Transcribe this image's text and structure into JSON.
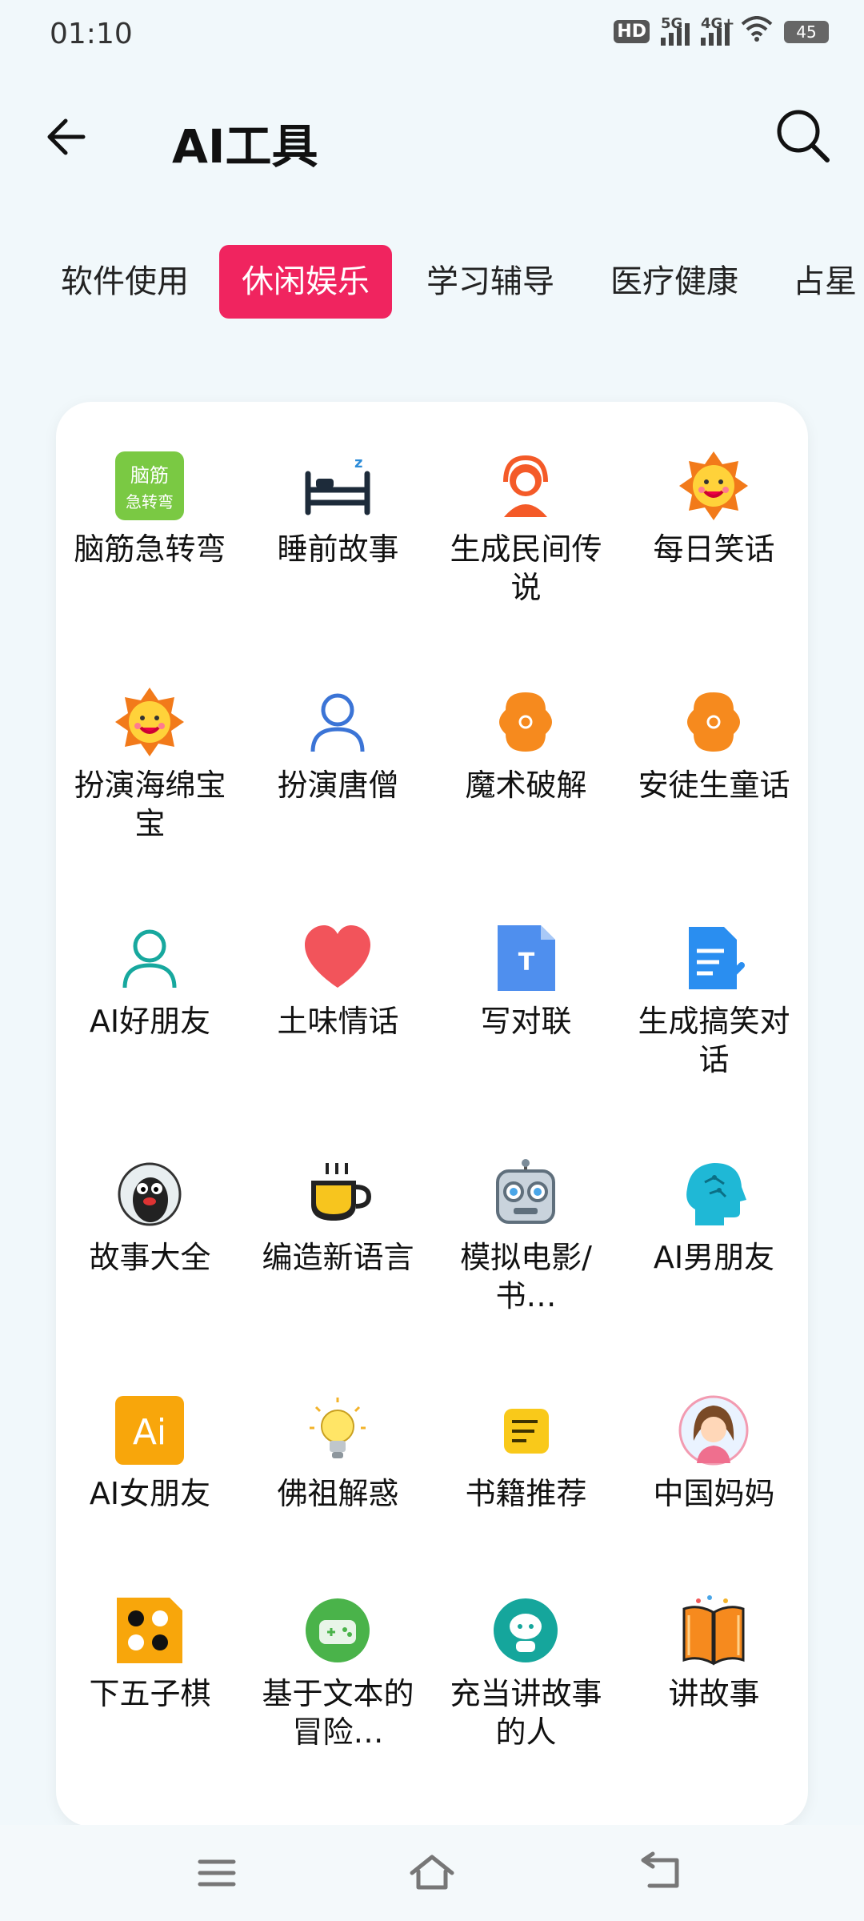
{
  "status_bar": {
    "time": "01:10",
    "hd": "HD",
    "net1": "5G",
    "net2": "4G+",
    "battery": "45"
  },
  "header": {
    "title": "AI工具",
    "back_icon": "arrow-left-icon",
    "search_icon": "search-icon"
  },
  "tabs": [
    {
      "label": "软件使用",
      "active": false
    },
    {
      "label": "休闲娱乐",
      "active": true
    },
    {
      "label": "学习辅导",
      "active": false
    },
    {
      "label": "医疗健康",
      "active": false
    },
    {
      "label": "占星",
      "active": false
    }
  ],
  "tools": [
    {
      "label": "脑筋急转弯",
      "icon": "brain-teaser-icon"
    },
    {
      "label": "睡前故事",
      "icon": "bed-icon"
    },
    {
      "label": "生成民间传说",
      "icon": "headset-person-icon"
    },
    {
      "label": "每日笑话",
      "icon": "sun-face-icon"
    },
    {
      "label": "扮演海绵宝宝",
      "icon": "sun-face-icon"
    },
    {
      "label": "扮演唐僧",
      "icon": "person-outline-icon"
    },
    {
      "label": "魔术破解",
      "icon": "orange-flower-icon"
    },
    {
      "label": "安徒生童话",
      "icon": "orange-flower-icon"
    },
    {
      "label": "AI好朋友",
      "icon": "person-outline-icon"
    },
    {
      "label": "土味情话",
      "icon": "heart-icon"
    },
    {
      "label": "写对联",
      "icon": "text-document-icon"
    },
    {
      "label": "生成搞笑对话",
      "icon": "edit-document-icon"
    },
    {
      "label": "故事大全",
      "icon": "mole-cartoon-icon"
    },
    {
      "label": "编造新语言",
      "icon": "coffee-cup-icon"
    },
    {
      "label": "模拟电影/书…",
      "icon": "robot-icon"
    },
    {
      "label": "AI男朋友",
      "icon": "ai-head-icon"
    },
    {
      "label": "AI女朋友",
      "icon": "ai-logo-icon"
    },
    {
      "label": "佛祖解惑",
      "icon": "lightbulb-icon"
    },
    {
      "label": "书籍推荐",
      "icon": "note-icon"
    },
    {
      "label": "中国妈妈",
      "icon": "woman-avatar-icon"
    },
    {
      "label": "下五子棋",
      "icon": "gomoku-icon"
    },
    {
      "label": "基于文本的冒险…",
      "icon": "game-controller-icon"
    },
    {
      "label": "充当讲故事的人",
      "icon": "storyteller-robot-icon"
    },
    {
      "label": "讲故事",
      "icon": "open-book-icon"
    }
  ],
  "nav_bar": {
    "menu_icon": "menu-icon",
    "home_icon": "home-icon",
    "back_icon": "back-nav-icon"
  }
}
